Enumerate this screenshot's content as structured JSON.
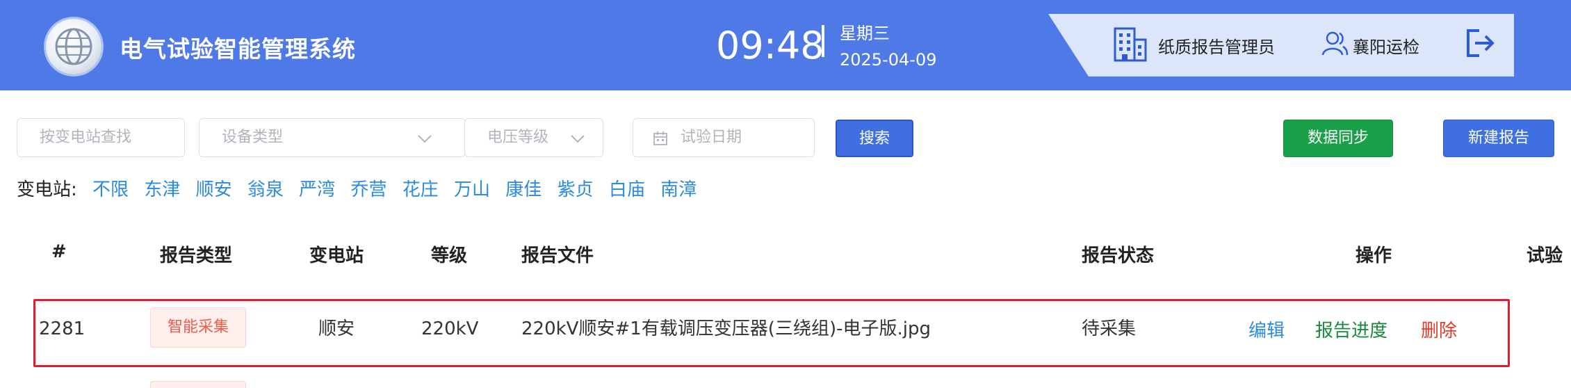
{
  "header": {
    "app_title": "电气试验智能管理系统",
    "time": "09:48",
    "weekday": "星期三",
    "date": "2025-04-09",
    "role": "纸质报告管理员",
    "org": "襄阳运检"
  },
  "filters": {
    "station_placeholder": "按变电站查找",
    "device_type_placeholder": "设备类型",
    "voltage_placeholder": "电压等级",
    "date_placeholder": "试验日期",
    "search_label": "搜索",
    "sync_label": "数据同步",
    "new_report_label": "新建报告"
  },
  "station_filter": {
    "label": "变电站:",
    "items": [
      "不限",
      "东津",
      "顺安",
      "翁泉",
      "严湾",
      "乔营",
      "花庄",
      "万山",
      "康佳",
      "紫贞",
      "白庙",
      "南漳"
    ]
  },
  "table": {
    "headers": [
      "#",
      "报告类型",
      "变电站",
      "等级",
      "报告文件",
      "报告状态",
      "操作",
      "试验"
    ],
    "rows": [
      {
        "id": "2281",
        "type": "智能采集",
        "station": "顺安",
        "level": "220kV",
        "file": "220kV顺安#1有载调压变压器(三绕组)-电子版.jpg",
        "status": "待采集",
        "actions": [
          "编辑",
          "报告进度",
          "删除"
        ]
      }
    ]
  },
  "colors": {
    "header_bg": "#4f79e6",
    "primary": "#3f6fe0",
    "success": "#1aa048",
    "danger": "#e23b2a",
    "link": "#2a8be0",
    "highlight_border": "#e01d35"
  },
  "icons": [
    "logo-emblem-icon",
    "building-icon",
    "person-icon",
    "logout-icon",
    "chevron-down-icon",
    "calendar-icon"
  ]
}
